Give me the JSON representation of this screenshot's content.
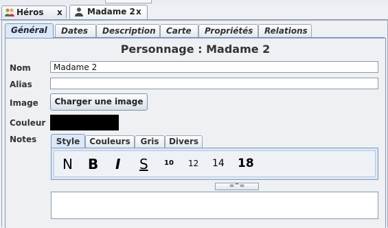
{
  "doc_tabs": [
    {
      "label": "Héros",
      "close": "x",
      "icon": "heroes-group-icon"
    },
    {
      "label": "Madame 2",
      "close": "x",
      "icon": "person-icon"
    }
  ],
  "section_tabs": [
    "Général",
    "Dates",
    "Description",
    "Carte",
    "Propriétés",
    "Relations"
  ],
  "title": "Personnage : Madame 2",
  "form": {
    "nom_label": "Nom",
    "nom_value": "Madame 2",
    "alias_label": "Alias",
    "alias_value": "",
    "image_label": "Image",
    "image_button": "Charger une image",
    "couleur_label": "Couleur",
    "couleur_value": "#000000",
    "notes_label": "Notes"
  },
  "notes_tabs": [
    "Style",
    "Couleurs",
    "Gris",
    "Divers"
  ],
  "toolbar": {
    "normal": "N",
    "bold": "B",
    "italic": "I",
    "strike": "S",
    "size10": "10",
    "size12": "12",
    "size14": "14",
    "size18": "18"
  },
  "splitter": "=^="
}
